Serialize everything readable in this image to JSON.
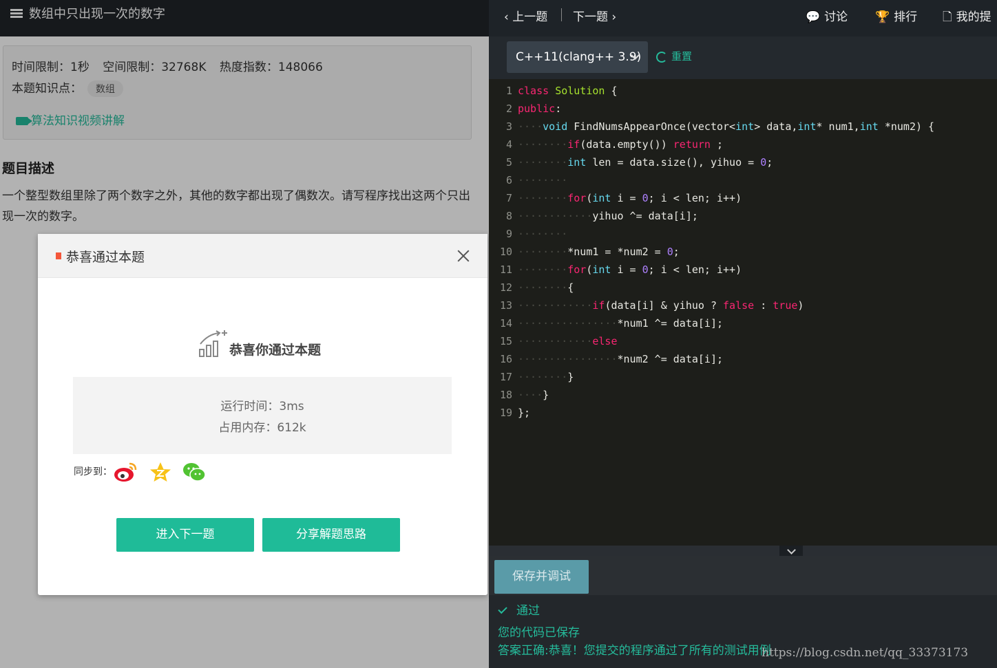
{
  "problem": {
    "title": "数组中只出现一次的数字",
    "time_limit": "时间限制：1秒",
    "space_limit": "空间限制：32768K",
    "heat_index": "热度指数：148066",
    "knowledge_label": "本题知识点：",
    "knowledge_tag": "数组",
    "video_link": "算法知识视频讲解",
    "desc_heading": "题目描述",
    "desc_text": "一个整型数组里除了两个数字之外，其他的数字都出现了偶数次。请写程序找出这两个只出现一次的数字。"
  },
  "modal": {
    "title": "恭喜通过本题",
    "success_text": "恭喜你通过本题",
    "runtime": "运行时间：3ms",
    "memory": "占用内存：612k",
    "sync_label": "同步到：",
    "share_targets": [
      "weibo-icon",
      "qzone-icon",
      "wechat-icon"
    ],
    "next_button": "进入下一题",
    "share_button": "分享解题思路"
  },
  "nav": {
    "prev": "上一题",
    "next": "下一题",
    "discuss": "讨论",
    "rank": "排行",
    "mine": "我的提"
  },
  "toolbar": {
    "language": "C++11(clang++ 3.9)",
    "reset": "重置"
  },
  "code": [
    {
      "n": "1",
      "t": "class Solution {"
    },
    {
      "n": "2",
      "t": "public:"
    },
    {
      "n": "3",
      "t": "    void FindNumsAppearOnce(vector<int> data,int* num1,int *num2) {"
    },
    {
      "n": "4",
      "t": "        if(data.empty()) return ;"
    },
    {
      "n": "5",
      "t": "        int len = data.size(), yihuo = 0;"
    },
    {
      "n": "6",
      "t": "        "
    },
    {
      "n": "7",
      "t": "        for(int i = 0; i < len; i++)"
    },
    {
      "n": "8",
      "t": "            yihuo ^= data[i];"
    },
    {
      "n": "9",
      "t": "        "
    },
    {
      "n": "10",
      "t": "        *num1 = *num2 = 0;"
    },
    {
      "n": "11",
      "t": "        for(int i = 0; i < len; i++)"
    },
    {
      "n": "12",
      "t": "        {"
    },
    {
      "n": "13",
      "t": "            if(data[i] & yihuo ? false : true)"
    },
    {
      "n": "14",
      "t": "                *num1 ^= data[i];"
    },
    {
      "n": "15",
      "t": "            else"
    },
    {
      "n": "16",
      "t": "                *num2 ^= data[i];"
    },
    {
      "n": "17",
      "t": "        }"
    },
    {
      "n": "18",
      "t": "    }"
    },
    {
      "n": "19",
      "t": "};"
    }
  ],
  "bottom": {
    "save_button": "保存并调试",
    "status": "通过",
    "saved_msg": "您的代码已保存",
    "result_msg": "答案正确:恭喜！您提交的程序通过了所有的测试用例",
    "watermark": "https://blog.csdn.net/qq_33373173"
  },
  "colors": {
    "accent": "#1fbb98",
    "header_bg": "#202429",
    "editor_bg": "#1d1e1a",
    "marker": "#f4573b"
  }
}
